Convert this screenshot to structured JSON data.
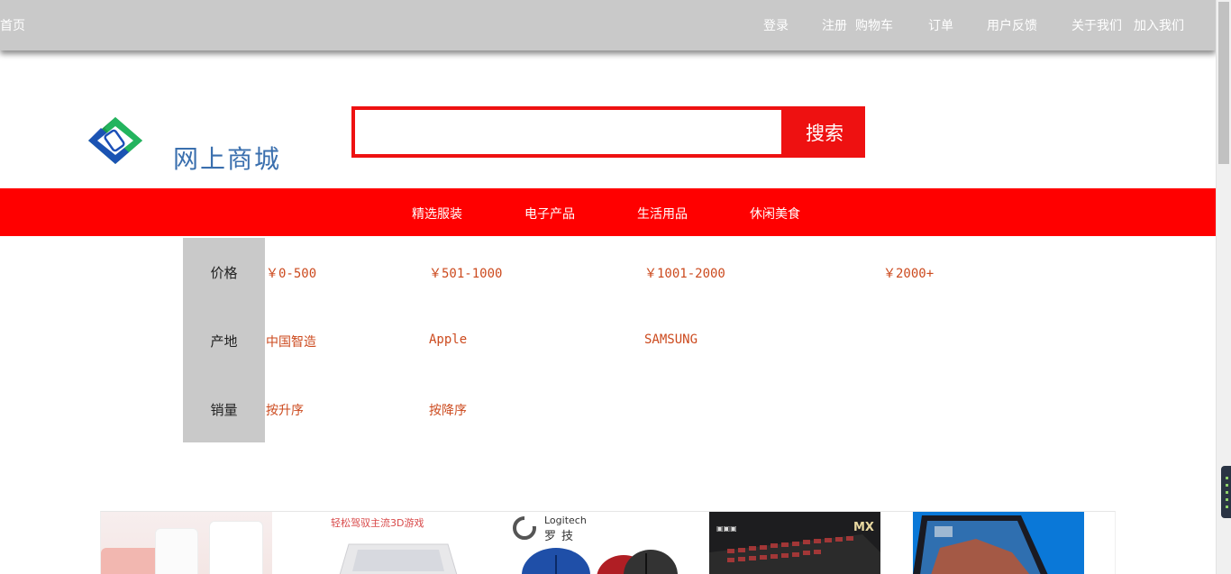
{
  "topnav": {
    "home": "首页",
    "login": "登录",
    "register": "注册",
    "cart": "购物车",
    "orders": "订单",
    "feedback": "用户反馈",
    "about": "关于我们",
    "join": "加入我们"
  },
  "header": {
    "brand": "网上商城",
    "search_placeholder": "",
    "search_button": "搜索"
  },
  "categories": [
    "精选服装",
    "电子产品",
    "生活用品",
    "休闲美食"
  ],
  "filters": {
    "price": {
      "label": "价格",
      "options": [
        "￥0-500",
        "￥501-1000",
        "￥1001-2000",
        "￥2000+"
      ]
    },
    "origin": {
      "label": "产地",
      "options": [
        "中国智造",
        "Apple",
        "SAMSUNG"
      ]
    },
    "sales": {
      "label": "销量",
      "options": [
        "按升序",
        "按降序"
      ]
    }
  },
  "products": {
    "p2_caption": "轻松驾驭主流3D游戏",
    "p3_brand": "Logitech",
    "p3_brand_cn": "罗技",
    "p4_text": "MX"
  },
  "colors": {
    "accent": "#ff0000",
    "topbar": "#c9c9c9",
    "filter_link": "#cc4a1e",
    "brand_text": "#3a6fae"
  },
  "icons": {
    "logo": "shop-logo-icon"
  }
}
